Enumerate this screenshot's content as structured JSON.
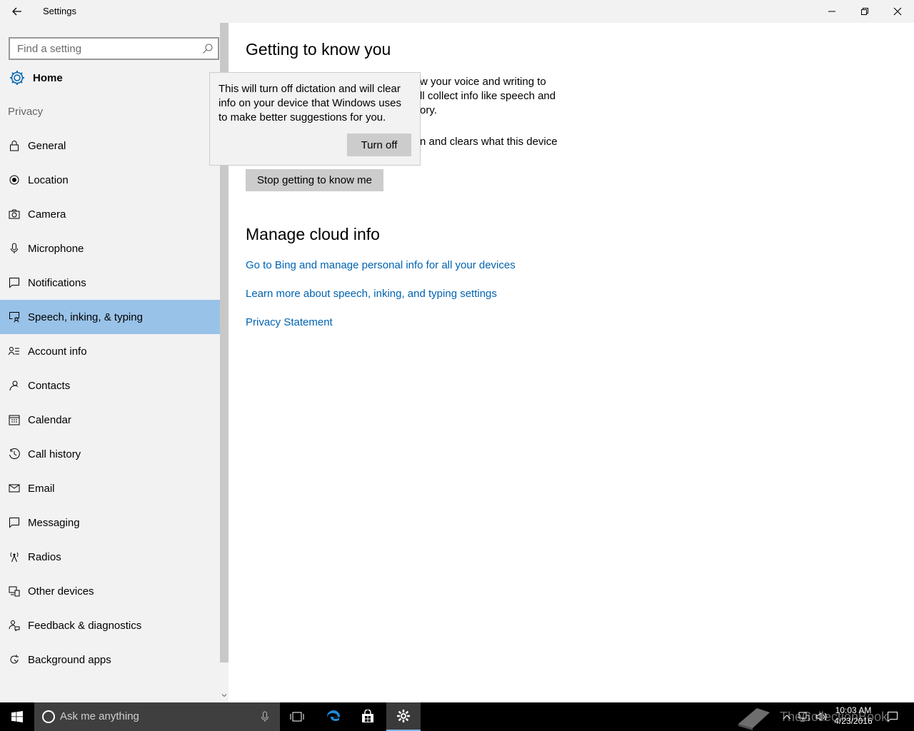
{
  "window": {
    "title": "Settings",
    "controls": [
      "minimize",
      "restore",
      "close"
    ]
  },
  "sidebar": {
    "search_placeholder": "Find a setting",
    "home_label": "Home",
    "section_label": "Privacy",
    "items": [
      {
        "label": "General",
        "icon": "lock-icon"
      },
      {
        "label": "Location",
        "icon": "location-icon"
      },
      {
        "label": "Camera",
        "icon": "camera-icon"
      },
      {
        "label": "Microphone",
        "icon": "microphone-icon"
      },
      {
        "label": "Notifications",
        "icon": "notifications-icon"
      },
      {
        "label": "Speech, inking, & typing",
        "icon": "speech-inking-icon",
        "selected": true
      },
      {
        "label": "Account info",
        "icon": "account-info-icon"
      },
      {
        "label": "Contacts",
        "icon": "contacts-icon"
      },
      {
        "label": "Calendar",
        "icon": "calendar-icon"
      },
      {
        "label": "Call history",
        "icon": "call-history-icon"
      },
      {
        "label": "Email",
        "icon": "email-icon"
      },
      {
        "label": "Messaging",
        "icon": "messaging-icon"
      },
      {
        "label": "Radios",
        "icon": "radios-icon"
      },
      {
        "label": "Other devices",
        "icon": "other-devices-icon"
      },
      {
        "label": "Feedback & diagnostics",
        "icon": "feedback-icon"
      },
      {
        "label": "Background apps",
        "icon": "background-apps-icon"
      }
    ]
  },
  "main": {
    "heading": "Getting to know you",
    "para1_visible": "w your voice and writing to\nll collect info like speech and\nory.",
    "para2_visible": "n and clears what this device",
    "stop_button": "Stop getting to know me",
    "cloud_heading": "Manage cloud info",
    "links": [
      "Go to Bing and manage personal info for all your devices",
      "Learn more about speech, inking, and typing settings",
      "Privacy Statement"
    ]
  },
  "flyout": {
    "message": "This will turn off dictation and will clear info on your device that Windows uses to make better suggestions for you.",
    "button": "Turn off"
  },
  "taskbar": {
    "search_placeholder": "Ask me anything",
    "clock_time": "10:03 AM",
    "clock_date": "4/23/2016",
    "watermark": "TheCollectionBook"
  },
  "colors": {
    "accent": "#0063b1",
    "selected_nav": "#99c2e8",
    "sidebar_bg": "#f2f2f2",
    "taskbar_bg": "#000000"
  }
}
